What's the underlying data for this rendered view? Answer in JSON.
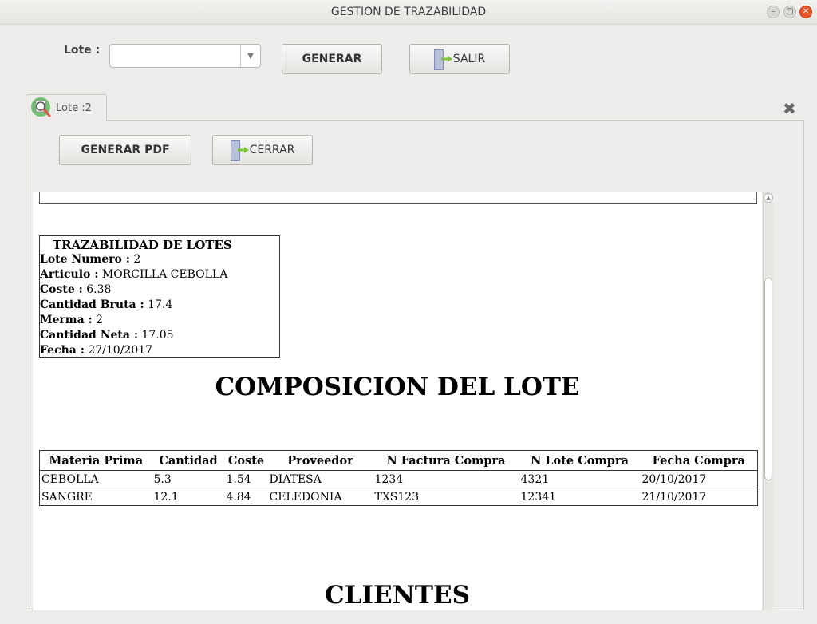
{
  "window": {
    "title": "GESTION DE TRAZABILIDAD",
    "min_label": "–",
    "max_label": "▢",
    "close_label": "✕"
  },
  "toolbar": {
    "lote_label": "Lote :",
    "lote_value": "",
    "generar_label": "GENERAR",
    "salir_label": "SALIR"
  },
  "tab": {
    "label": "Lote :2",
    "close_label": "✖"
  },
  "panel": {
    "generar_pdf_label": "GENERAR PDF",
    "cerrar_label": "CERRAR"
  },
  "report": {
    "info_title": "TRAZABILIDAD DE LOTES",
    "info_rows": [
      {
        "label": "Lote Numero :",
        "value": "2"
      },
      {
        "label": "Articulo :",
        "value": "MORCILLA CEBOLLA"
      },
      {
        "label": "Coste :",
        "value": "6.38"
      },
      {
        "label": "Cantidad Bruta :",
        "value": "17.4"
      },
      {
        "label": "Merma :",
        "value": "2"
      },
      {
        "label": "Cantidad Neta :",
        "value": "17.05"
      },
      {
        "label": "Fecha :",
        "value": "27/10/2017"
      }
    ],
    "composition_title": "COMPOSICION DEL LOTE",
    "table_headers": [
      "Materia Prima",
      "Cantidad",
      "Coste",
      "Proveedor",
      "N Factura Compra",
      "N Lote Compra",
      "Fecha Compra"
    ],
    "table_rows": [
      [
        "CEBOLLA",
        "5.3",
        "1.54",
        "DIATESA",
        "1234",
        "4321",
        "20/10/2017"
      ],
      [
        "SANGRE",
        "12.1",
        "4.84",
        "CELEDONIA",
        "TXS123",
        "12341",
        "21/10/2017"
      ]
    ],
    "clients_title": "CLIENTES"
  },
  "colors": {
    "exit_arrow": "#7cc23d",
    "search_icon_ring": "#5cb85c",
    "close_button": "#e9542a"
  }
}
